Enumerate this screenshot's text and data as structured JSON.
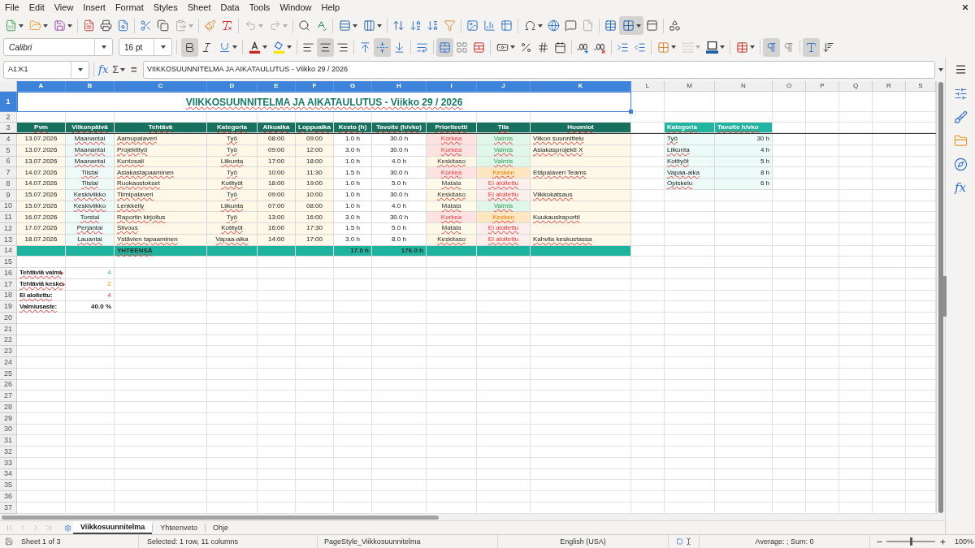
{
  "menu_bar": {
    "items": [
      "File",
      "Edit",
      "View",
      "Insert",
      "Format",
      "Styles",
      "Sheet",
      "Data",
      "Tools",
      "Window",
      "Help"
    ]
  },
  "standard_toolbar": {
    "groups": [
      [
        {
          "kind": "new",
          "dropdown": true,
          "disabled": false,
          "pressed": false
        },
        {
          "kind": "open",
          "dropdown": true,
          "disabled": false,
          "pressed": false
        },
        {
          "kind": "save",
          "dropdown": true,
          "disabled": false,
          "pressed": false
        }
      ],
      [
        {
          "kind": "pdf",
          "dropdown": false,
          "disabled": false,
          "pressed": false
        },
        {
          "kind": "print",
          "dropdown": false,
          "disabled": false,
          "pressed": false
        },
        {
          "kind": "preview",
          "dropdown": false,
          "disabled": false,
          "pressed": false
        }
      ],
      [
        {
          "kind": "cut",
          "dropdown": false,
          "disabled": false,
          "pressed": false
        },
        {
          "kind": "copy",
          "dropdown": false,
          "disabled": false,
          "pressed": false
        },
        {
          "kind": "paste",
          "dropdown": true,
          "disabled": true,
          "pressed": false
        }
      ],
      [
        {
          "kind": "clone",
          "dropdown": false,
          "disabled": false,
          "pressed": false
        },
        {
          "kind": "clear",
          "dropdown": false,
          "disabled": false,
          "pressed": false
        }
      ],
      [
        {
          "kind": "undo",
          "dropdown": true,
          "disabled": true,
          "pressed": false
        },
        {
          "kind": "redo",
          "dropdown": true,
          "disabled": true,
          "pressed": false
        }
      ],
      [
        {
          "kind": "find",
          "dropdown": false,
          "disabled": false,
          "pressed": false
        },
        {
          "kind": "spelling",
          "dropdown": false,
          "disabled": false,
          "pressed": false
        }
      ],
      [
        {
          "kind": "rows",
          "dropdown": true,
          "disabled": false,
          "pressed": false
        },
        {
          "kind": "columns",
          "dropdown": true,
          "disabled": false,
          "pressed": false
        }
      ],
      [
        {
          "kind": "sort",
          "dropdown": false,
          "disabled": false,
          "pressed": false
        },
        {
          "kind": "sortup",
          "dropdown": false,
          "disabled": false,
          "pressed": false
        },
        {
          "kind": "sortdown",
          "dropdown": false,
          "disabled": false,
          "pressed": false
        },
        {
          "kind": "filter",
          "dropdown": false,
          "disabled": false,
          "pressed": false
        }
      ],
      [
        {
          "kind": "image",
          "dropdown": false,
          "disabled": false,
          "pressed": false
        },
        {
          "kind": "chart",
          "dropdown": false,
          "disabled": false,
          "pressed": false
        },
        {
          "kind": "pivot",
          "dropdown": false,
          "disabled": false,
          "pressed": false
        }
      ],
      [
        {
          "kind": "special",
          "dropdown": true,
          "disabled": false,
          "pressed": false
        },
        {
          "kind": "link",
          "dropdown": false,
          "disabled": false,
          "pressed": false
        },
        {
          "kind": "comment",
          "dropdown": false,
          "disabled": false,
          "pressed": false
        },
        {
          "kind": "headerfooter",
          "dropdown": false,
          "disabled": true,
          "pressed": false
        }
      ],
      [
        {
          "kind": "printarea",
          "dropdown": false,
          "disabled": false,
          "pressed": false
        },
        {
          "kind": "freeze",
          "dropdown": true,
          "disabled": false,
          "pressed": true
        },
        {
          "kind": "split",
          "dropdown": false,
          "disabled": false,
          "pressed": false
        }
      ],
      [
        {
          "kind": "shapes",
          "dropdown": false,
          "disabled": false,
          "pressed": false
        }
      ]
    ]
  },
  "formatting_toolbar": {
    "font_name": "Calibri",
    "font_size": "16 pt",
    "groups": [
      [
        {
          "kind": "bold",
          "dropdown": false,
          "disabled": false,
          "pressed": true
        },
        {
          "kind": "italic",
          "dropdown": false,
          "disabled": false,
          "pressed": false
        },
        {
          "kind": "underline",
          "dropdown": true,
          "disabled": false,
          "pressed": false
        }
      ],
      [
        {
          "kind": "fontcolor",
          "dropdown": true,
          "disabled": false,
          "pressed": false
        },
        {
          "kind": "highlight",
          "dropdown": true,
          "disabled": false,
          "pressed": false
        }
      ],
      [
        {
          "kind": "alignleft",
          "dropdown": false,
          "disabled": false,
          "pressed": false
        },
        {
          "kind": "aligncenter",
          "dropdown": false,
          "disabled": false,
          "pressed": true
        },
        {
          "kind": "alignright",
          "dropdown": false,
          "disabled": false,
          "pressed": false
        }
      ],
      [
        {
          "kind": "aligntop",
          "dropdown": false,
          "disabled": false,
          "pressed": false
        },
        {
          "kind": "alignmiddle",
          "dropdown": false,
          "disabled": false,
          "pressed": true
        },
        {
          "kind": "alignbottom",
          "dropdown": false,
          "disabled": false,
          "pressed": false
        }
      ],
      [
        {
          "kind": "wrap",
          "dropdown": false,
          "disabled": false,
          "pressed": false
        }
      ],
      [
        {
          "kind": "mergecenter",
          "dropdown": false,
          "disabled": false,
          "pressed": true
        },
        {
          "kind": "merge",
          "dropdown": false,
          "disabled": false,
          "pressed": false
        },
        {
          "kind": "unmerge",
          "dropdown": false,
          "disabled": false,
          "pressed": false
        }
      ],
      [
        {
          "kind": "currency",
          "dropdown": true,
          "disabled": false,
          "pressed": false
        },
        {
          "kind": "percent",
          "dropdown": false,
          "disabled": false,
          "pressed": false
        },
        {
          "kind": "decimal",
          "dropdown": false,
          "disabled": false,
          "pressed": false
        },
        {
          "kind": "date",
          "dropdown": false,
          "disabled": false,
          "pressed": false
        }
      ],
      [
        {
          "kind": "adddecimal",
          "dropdown": false,
          "disabled": false,
          "pressed": false
        },
        {
          "kind": "deldecimal",
          "dropdown": false,
          "disabled": false,
          "pressed": false
        }
      ],
      [
        {
          "kind": "indent",
          "dropdown": false,
          "disabled": false,
          "pressed": false
        },
        {
          "kind": "outdent",
          "dropdown": false,
          "disabled": false,
          "pressed": false
        }
      ],
      [
        {
          "kind": "borders",
          "dropdown": true,
          "disabled": false,
          "pressed": false
        },
        {
          "kind": "borderstyle",
          "dropdown": true,
          "disabled": true,
          "pressed": false
        },
        {
          "kind": "bordercolor",
          "dropdown": true,
          "disabled": false,
          "pressed": false
        }
      ],
      [
        {
          "kind": "conditional",
          "dropdown": true,
          "disabled": false,
          "pressed": false
        }
      ],
      [
        {
          "kind": "ltr",
          "dropdown": false,
          "disabled": false,
          "pressed": true
        },
        {
          "kind": "rtl",
          "dropdown": false,
          "disabled": false,
          "pressed": false
        }
      ],
      [
        {
          "kind": "orientation",
          "dropdown": false,
          "disabled": false,
          "pressed": true
        },
        {
          "kind": "textsort",
          "dropdown": false,
          "disabled": false,
          "pressed": false
        }
      ]
    ]
  },
  "formula_bar": {
    "name_box": "A1:K1",
    "function_wizard": "fx",
    "sum": "Σ",
    "formula": "=",
    "content": "VIIKKOSUUNNITELMA JA AIKATAULUTUS - Viikko 29 / 2026"
  },
  "sidebar": {
    "items": [
      {
        "kind": "properties",
        "selected": false
      },
      {
        "kind": "styles",
        "selected": false
      },
      {
        "kind": "gallery",
        "selected": false
      },
      {
        "kind": "navigator",
        "selected": false
      },
      {
        "kind": "functions",
        "label": "fx",
        "selected": false
      }
    ]
  },
  "sheet": {
    "spelling_marks": true,
    "column_headers": [
      {
        "label": "A",
        "selected": true
      },
      {
        "label": "B",
        "selected": true
      },
      {
        "label": "C",
        "selected": true
      },
      {
        "label": "D",
        "selected": true
      },
      {
        "label": "E",
        "selected": true
      },
      {
        "label": "F",
        "selected": true
      },
      {
        "label": "G",
        "selected": true
      },
      {
        "label": "H",
        "selected": true
      },
      {
        "label": "I",
        "selected": true
      },
      {
        "label": "J",
        "selected": true
      },
      {
        "label": "K",
        "selected": true
      },
      {
        "label": "L",
        "selected": false
      },
      {
        "label": "M",
        "selected": false
      },
      {
        "label": "N",
        "selected": false
      },
      {
        "label": "O",
        "selected": false
      },
      {
        "label": "P",
        "selected": false
      },
      {
        "label": "Q",
        "selected": false
      },
      {
        "label": "R",
        "selected": false
      },
      {
        "label": "S",
        "selected": false
      }
    ],
    "row_headers": [
      {
        "label": "1",
        "selected": true
      },
      {
        "label": "2",
        "selected": false
      },
      {
        "label": "3",
        "selected": false
      },
      {
        "label": "4",
        "selected": false
      },
      {
        "label": "5",
        "selected": false
      },
      {
        "label": "6",
        "selected": false
      },
      {
        "label": "7",
        "selected": false
      },
      {
        "label": "8",
        "selected": false
      },
      {
        "label": "9",
        "selected": false
      },
      {
        "label": "10",
        "selected": false
      },
      {
        "label": "11",
        "selected": false
      },
      {
        "label": "12",
        "selected": false
      },
      {
        "label": "13",
        "selected": false
      },
      {
        "label": "14",
        "selected": false
      },
      {
        "label": "15",
        "selected": false
      },
      {
        "label": "16",
        "selected": false
      },
      {
        "label": "17",
        "selected": false
      },
      {
        "label": "18",
        "selected": false
      },
      {
        "label": "19",
        "selected": false
      },
      {
        "label": "20",
        "selected": false
      },
      {
        "label": "21",
        "selected": false
      },
      {
        "label": "22",
        "selected": false
      },
      {
        "label": "23",
        "selected": false
      },
      {
        "label": "24",
        "selected": false
      },
      {
        "label": "25",
        "selected": false
      },
      {
        "label": "26",
        "selected": false
      },
      {
        "label": "27",
        "selected": false
      },
      {
        "label": "28",
        "selected": false
      },
      {
        "label": "29",
        "selected": false
      },
      {
        "label": "30",
        "selected": false
      },
      {
        "label": "31",
        "selected": false
      },
      {
        "label": "32",
        "selected": false
      },
      {
        "label": "33",
        "selected": false
      },
      {
        "label": "34",
        "selected": false
      },
      {
        "label": "35",
        "selected": false
      },
      {
        "label": "36",
        "selected": false
      },
      {
        "label": "37",
        "selected": false
      }
    ],
    "title": {
      "text": "VIIKKOSUUNNITELMA JA AIKATAULUTUS - Viikko 29 / 2026",
      "selected": true
    },
    "table": {
      "columns": [
        "Pvm",
        "Viikonpäivä",
        "Tehtävä",
        "Kategoria",
        "Alkuaika",
        "Loppuaika",
        "Kesto (h)",
        "Tavoite (h/vko)",
        "Prioriteetti",
        "Tila",
        "Huomiot"
      ],
      "rows": [
        {
          "date": "13.07.2026",
          "weekday": "Maanantai",
          "task": "Aamupalaveri",
          "category": "Työ",
          "start": "08:00",
          "end": "09:00",
          "duration": "1.0 h",
          "target": "30.0 h",
          "priority": {
            "text": "Korkea",
            "kind": "high"
          },
          "status": {
            "text": "Valmis",
            "kind": "done"
          },
          "notes": "Viikon suunnittelu"
        },
        {
          "date": "13.07.2026",
          "weekday": "Maanantai",
          "task": "Projektityö",
          "category": "Työ",
          "start": "09:00",
          "end": "12:00",
          "duration": "3.0 h",
          "target": "30.0 h",
          "priority": {
            "text": "Korkea",
            "kind": "high"
          },
          "status": {
            "text": "Valmis",
            "kind": "done"
          },
          "notes": "Asiakasprojekti X"
        },
        {
          "date": "13.07.2026",
          "weekday": "Maanantai",
          "task": "Kuntosali",
          "category": "Liikunta",
          "start": "17:00",
          "end": "18:00",
          "duration": "1.0 h",
          "target": "4.0 h",
          "priority": {
            "text": "Keskitaso",
            "kind": "medium"
          },
          "status": {
            "text": "Valmis",
            "kind": "done"
          }
        },
        {
          "date": "14.07.2026",
          "weekday": "Tiistai",
          "task": "Asiakastapaaminen",
          "category": "Työ",
          "start": "10:00",
          "end": "11:30",
          "duration": "1.5 h",
          "target": "30.0 h",
          "priority": {
            "text": "Korkea",
            "kind": "high"
          },
          "status": {
            "text": "Kesken",
            "kind": "progress"
          },
          "notes": "Etäpalaveri Teams"
        },
        {
          "date": "14.07.2026",
          "weekday": "Tiistai",
          "task": "Ruokaostokset",
          "category": "Kotityöt",
          "start": "18:00",
          "end": "19:00",
          "duration": "1.0 h",
          "target": "5.0 h",
          "priority": {
            "text": "Matala",
            "kind": "low"
          },
          "status": {
            "text": "Ei aloitettu",
            "kind": "todo"
          }
        },
        {
          "date": "15.07.2026",
          "weekday": "Keskiviikko",
          "task": "Tiimipalaveri",
          "category": "Työ",
          "start": "09:00",
          "end": "10:00",
          "duration": "1.0 h",
          "target": "30.0 h",
          "priority": {
            "text": "Keskitaso",
            "kind": "medium"
          },
          "status": {
            "text": "Ei aloitettu",
            "kind": "todo"
          },
          "notes": "Viikkokatsaus"
        },
        {
          "date": "15.07.2026",
          "weekday": "Keskiviikko",
          "task": "Lenkkeily",
          "category": "Liikunta",
          "start": "07:00",
          "end": "08:00",
          "duration": "1.0 h",
          "target": "4.0 h",
          "priority": {
            "text": "Matala",
            "kind": "low"
          },
          "status": {
            "text": "Valmis",
            "kind": "done"
          }
        },
        {
          "date": "16.07.2026",
          "weekday": "Torstai",
          "task": "Raportin kirjoitus",
          "category": "Työ",
          "start": "13:00",
          "end": "16:00",
          "duration": "3.0 h",
          "target": "30.0 h",
          "priority": {
            "text": "Korkea",
            "kind": "high"
          },
          "status": {
            "text": "Kesken",
            "kind": "progress"
          },
          "notes": "Kuukausiraportti"
        },
        {
          "date": "17.07.2026",
          "weekday": "Perjantai",
          "task": "Siivous",
          "category": "Kotityöt",
          "start": "16:00",
          "end": "17:30",
          "duration": "1.5 h",
          "target": "5.0 h",
          "priority": {
            "text": "Matala",
            "kind": "low"
          },
          "status": {
            "text": "Ei aloitettu",
            "kind": "todo"
          }
        },
        {
          "date": "18.07.2026",
          "weekday": "Lauantai",
          "task": "Ystävien tapaaminen",
          "category": "Vapaa-aika",
          "start": "14:00",
          "end": "17:00",
          "duration": "3.0 h",
          "target": "8.0 h",
          "priority": {
            "text": "Keskitaso",
            "kind": "medium"
          },
          "status": {
            "text": "Ei aloitettu",
            "kind": "todo"
          },
          "notes": "Kahvila keskustassa"
        }
      ],
      "total": {
        "label": "YHTEENSÄ",
        "duration": "17.0 h",
        "target": "176.0 h"
      }
    },
    "summary": [
      {
        "label": "Tehtäviä valmi",
        "value": "4",
        "kind": "done",
        "cut": true
      },
      {
        "label": "Tehtäviä keske",
        "value": "2",
        "kind": "progress",
        "cut": true
      },
      {
        "label": "Ei aloitettu:",
        "value": "4",
        "kind": "todo",
        "cut": false
      },
      {
        "label": "Valmiusaste:",
        "value": "40.0 %",
        "kind": "rate",
        "cut": false
      }
    ],
    "targets": {
      "columns": [
        "Kategoria",
        "Tavoite h/vko"
      ],
      "rows": [
        {
          "category": "Työ",
          "hours": "30 h"
        },
        {
          "category": "Liikunta",
          "hours": "4 h"
        },
        {
          "category": "Kotityöt",
          "hours": "5 h"
        },
        {
          "category": "Vapaa-aika",
          "hours": "8 h"
        },
        {
          "category": "Opiskelu",
          "hours": "6 h"
        }
      ]
    }
  },
  "sheet_tabs": {
    "navigation": [
      {
        "kind": "first",
        "disabled": true
      },
      {
        "kind": "previous",
        "disabled": true
      },
      {
        "kind": "next",
        "disabled": true
      },
      {
        "kind": "last",
        "disabled": true
      }
    ],
    "tabs": [
      {
        "label": "Viikkosuunnitelma",
        "selected": true
      },
      {
        "label": "Yhteenveto",
        "selected": false
      },
      {
        "label": "Ohje",
        "selected": false
      }
    ]
  },
  "status_bar": {
    "sheet": "Sheet 1 of 3",
    "selection": "Selected: 1 row, 11 columns",
    "page_style": "PageStyle_Viikkosuunnitelma",
    "language": "English (USA)",
    "summary": "Average: ; Sum: 0",
    "zoom": {
      "level": 0.5,
      "reading": "100%"
    }
  }
}
